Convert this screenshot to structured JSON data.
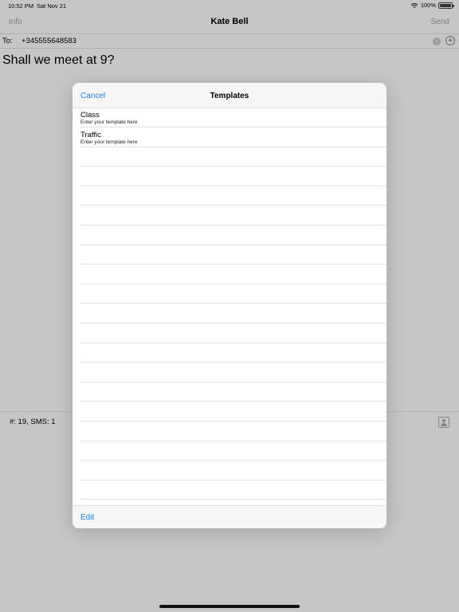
{
  "status": {
    "time": "10:52 PM",
    "date": "Sat Nov 21",
    "battery": "100%"
  },
  "nav": {
    "left": "Info",
    "title": "Kate Bell",
    "right": "Send"
  },
  "compose": {
    "to_label": "To:",
    "to_value": "+345555648583",
    "message": "Shall we meet at 9?"
  },
  "counter": "#: 19, SMS: 1",
  "templates": {
    "cancel": "Cancel",
    "title": "Templates",
    "edit": "Edit",
    "items": [
      {
        "title": "Class",
        "subtitle": "Enter your template here"
      },
      {
        "title": "Traffic",
        "subtitle": "Enter your template here"
      }
    ]
  }
}
